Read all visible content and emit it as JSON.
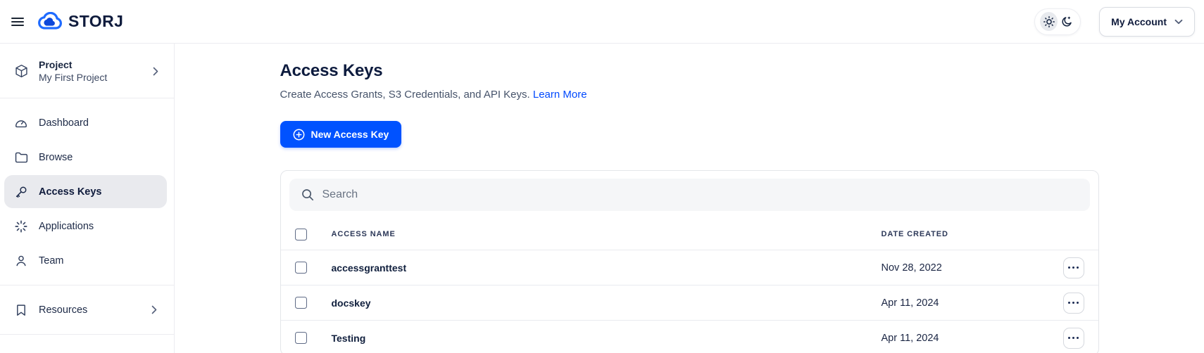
{
  "header": {
    "logo_text": "STORJ",
    "account_button": "My Account"
  },
  "sidebar": {
    "project": {
      "label": "Project",
      "name": "My First Project"
    },
    "items": [
      {
        "label": "Dashboard"
      },
      {
        "label": "Browse"
      },
      {
        "label": "Access Keys",
        "selected": true
      },
      {
        "label": "Applications"
      },
      {
        "label": "Team"
      }
    ],
    "resources_label": "Resources"
  },
  "main": {
    "title": "Access Keys",
    "subtitle": "Create Access Grants, S3 Credentials, and API Keys.",
    "learn_more_label": "Learn More",
    "new_key_button": "New Access Key",
    "search_placeholder": "Search",
    "table": {
      "columns": [
        "ACCESS NAME",
        "DATE CREATED"
      ],
      "rows": [
        {
          "name": "accessgranttest",
          "date": "Nov 28, 2022"
        },
        {
          "name": "docskey",
          "date": "Apr 11, 2024"
        },
        {
          "name": "Testing",
          "date": "Apr 11, 2024"
        }
      ]
    }
  },
  "colors": {
    "accent": "#0052ff",
    "navy": "#0f1b3c",
    "selected_bg": "#e9eaee"
  }
}
